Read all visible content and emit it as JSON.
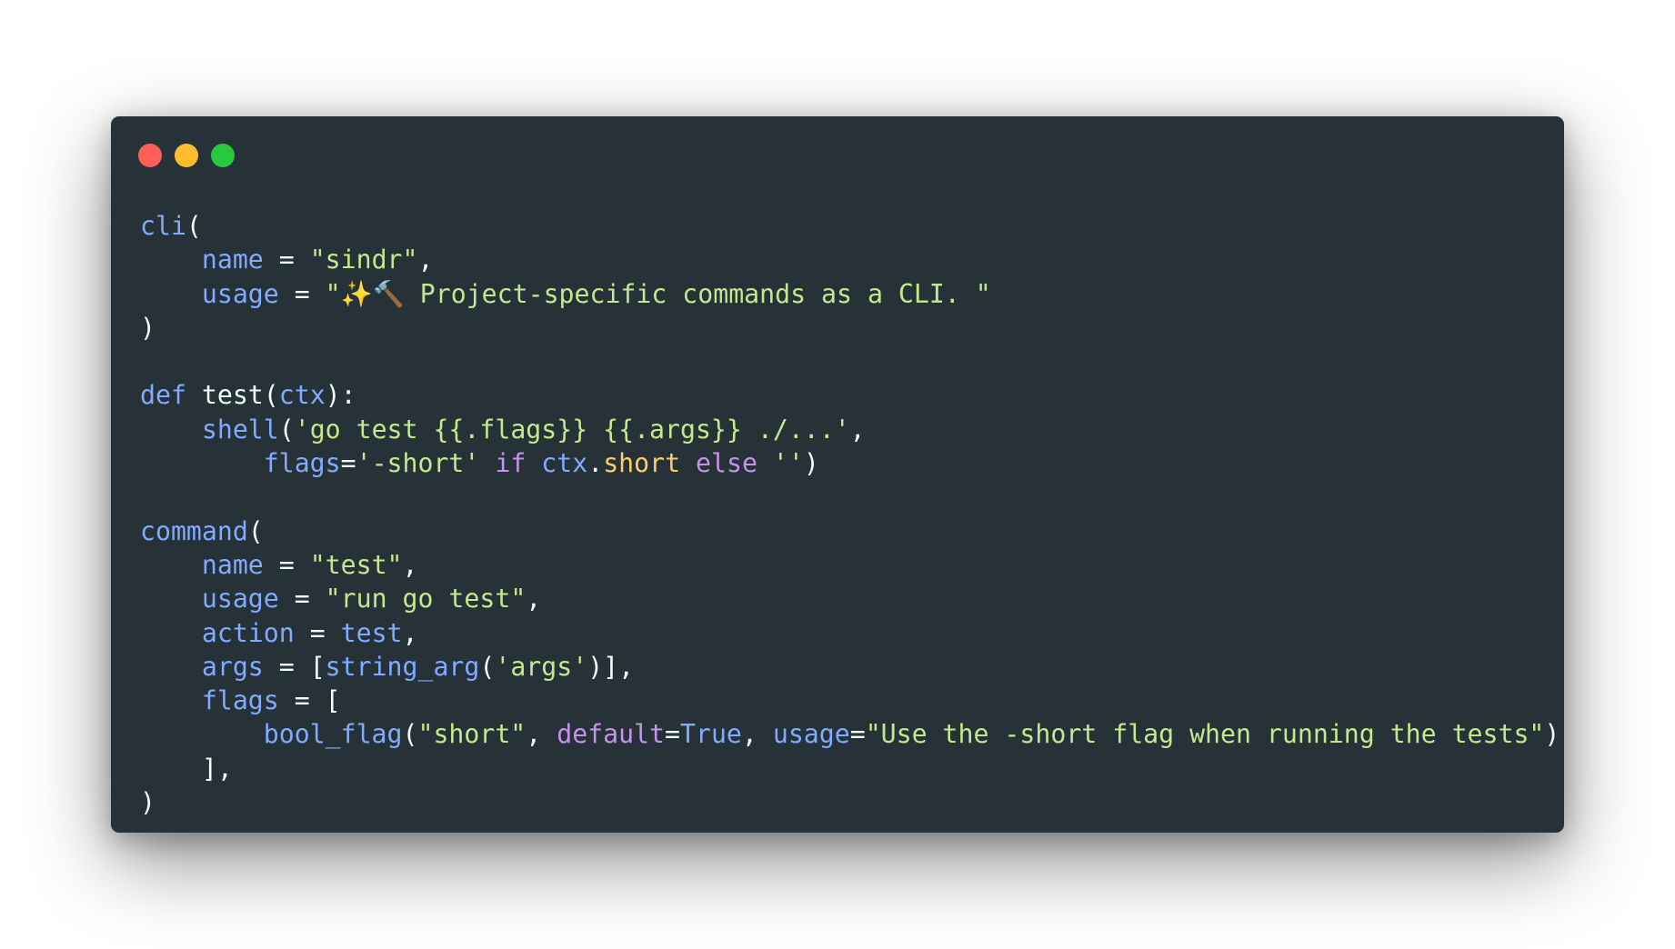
{
  "window": {
    "controls": [
      {
        "name": "close-button",
        "icon": "red-dot-icon",
        "color": "#ff5f56"
      },
      {
        "name": "minimize-button",
        "icon": "yellow-dot-icon",
        "color": "#ffbd2e"
      },
      {
        "name": "maximize-button",
        "icon": "green-dot-icon",
        "color": "#27c93f"
      }
    ],
    "background": "#263238"
  },
  "theme": {
    "default": "#eeffff",
    "function": "#82aaff",
    "string": "#c3e88d",
    "keyword": "#c792ea",
    "property": "#ffcb6b",
    "param": "#82aaff"
  },
  "code": {
    "lines": [
      [
        [
          "function",
          "cli"
        ],
        [
          "default",
          "("
        ]
      ],
      [
        [
          "default",
          "    "
        ],
        [
          "function",
          "name"
        ],
        [
          "default",
          " = "
        ],
        [
          "string",
          "\"sindr\""
        ],
        [
          "default",
          ","
        ]
      ],
      [
        [
          "default",
          "    "
        ],
        [
          "function",
          "usage"
        ],
        [
          "default",
          " = "
        ],
        [
          "string",
          "\"✨🔨 Project-specific commands as a CLI. \""
        ]
      ],
      [
        [
          "default",
          ")"
        ]
      ],
      [],
      [
        [
          "function",
          "def"
        ],
        [
          "default",
          " test("
        ],
        [
          "function",
          "ctx"
        ],
        [
          "default",
          "):"
        ]
      ],
      [
        [
          "default",
          "    "
        ],
        [
          "function",
          "shell"
        ],
        [
          "default",
          "("
        ],
        [
          "string",
          "'go test {{.flags}} {{.args}} ./...'"
        ],
        [
          "default",
          ","
        ]
      ],
      [
        [
          "default",
          "        "
        ],
        [
          "function",
          "flags"
        ],
        [
          "default",
          "="
        ],
        [
          "string",
          "'-short'"
        ],
        [
          "default",
          " "
        ],
        [
          "keyword",
          "if"
        ],
        [
          "default",
          " "
        ],
        [
          "function",
          "ctx"
        ],
        [
          "default",
          "."
        ],
        [
          "property",
          "short"
        ],
        [
          "default",
          " "
        ],
        [
          "keyword",
          "else"
        ],
        [
          "default",
          " "
        ],
        [
          "string",
          "''"
        ],
        [
          "default",
          ")"
        ]
      ],
      [],
      [
        [
          "function",
          "command"
        ],
        [
          "default",
          "("
        ]
      ],
      [
        [
          "default",
          "    "
        ],
        [
          "function",
          "name"
        ],
        [
          "default",
          " = "
        ],
        [
          "string",
          "\"test\""
        ],
        [
          "default",
          ","
        ]
      ],
      [
        [
          "default",
          "    "
        ],
        [
          "function",
          "usage"
        ],
        [
          "default",
          " = "
        ],
        [
          "string",
          "\"run go test\""
        ],
        [
          "default",
          ","
        ]
      ],
      [
        [
          "default",
          "    "
        ],
        [
          "function",
          "action"
        ],
        [
          "default",
          " = "
        ],
        [
          "function",
          "test"
        ],
        [
          "default",
          ","
        ]
      ],
      [
        [
          "default",
          "    "
        ],
        [
          "function",
          "args"
        ],
        [
          "default",
          " = ["
        ],
        [
          "function",
          "string_arg"
        ],
        [
          "default",
          "("
        ],
        [
          "string",
          "'args'"
        ],
        [
          "default",
          ")],"
        ]
      ],
      [
        [
          "default",
          "    "
        ],
        [
          "function",
          "flags"
        ],
        [
          "default",
          " = ["
        ]
      ],
      [
        [
          "default",
          "        "
        ],
        [
          "function",
          "bool_flag"
        ],
        [
          "default",
          "("
        ],
        [
          "string",
          "\"short\""
        ],
        [
          "default",
          ", "
        ],
        [
          "keyword",
          "default"
        ],
        [
          "default",
          "="
        ],
        [
          "function",
          "True"
        ],
        [
          "default",
          ", "
        ],
        [
          "function",
          "usage"
        ],
        [
          "default",
          "="
        ],
        [
          "string",
          "\"Use the -short flag when running the tests\""
        ],
        [
          "default",
          ")"
        ]
      ],
      [
        [
          "default",
          "    ],"
        ]
      ],
      [
        [
          "default",
          ")"
        ]
      ]
    ]
  }
}
